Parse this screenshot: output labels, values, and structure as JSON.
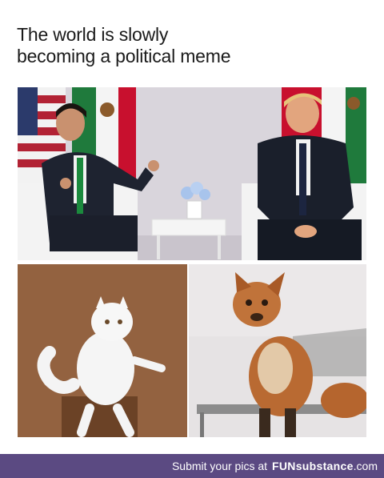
{
  "caption": {
    "line1": "The world is slowly",
    "line2": "becoming a political meme"
  },
  "footer": {
    "prefix": "Submit your pics at",
    "brand": "FUNsubstance",
    "suffix": ".com"
  }
}
